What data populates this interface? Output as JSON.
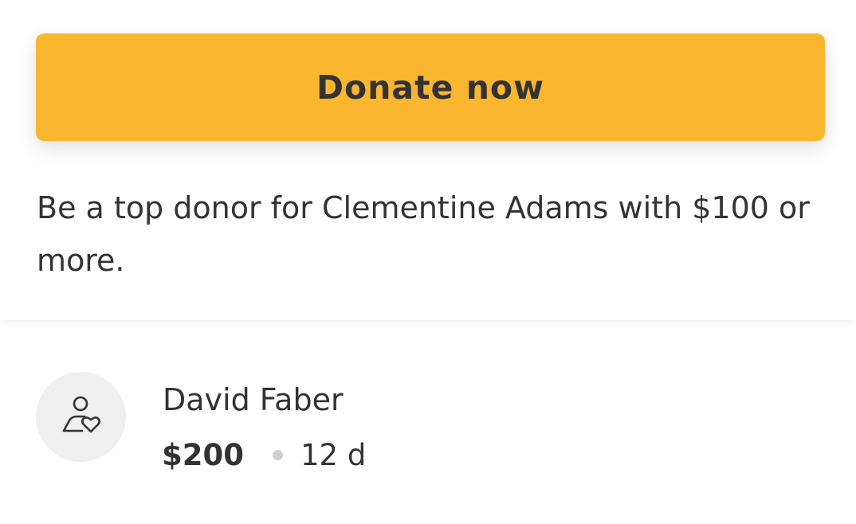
{
  "donate": {
    "button_label": "Donate now",
    "button_color": "#fbb630"
  },
  "top_donor": {
    "text": "Be a top donor for Clementine Adams with $100 or more."
  },
  "donation": {
    "avatar_icon": "person-heart-icon",
    "name": "David Faber",
    "amount": "$200",
    "time": "12 d"
  }
}
